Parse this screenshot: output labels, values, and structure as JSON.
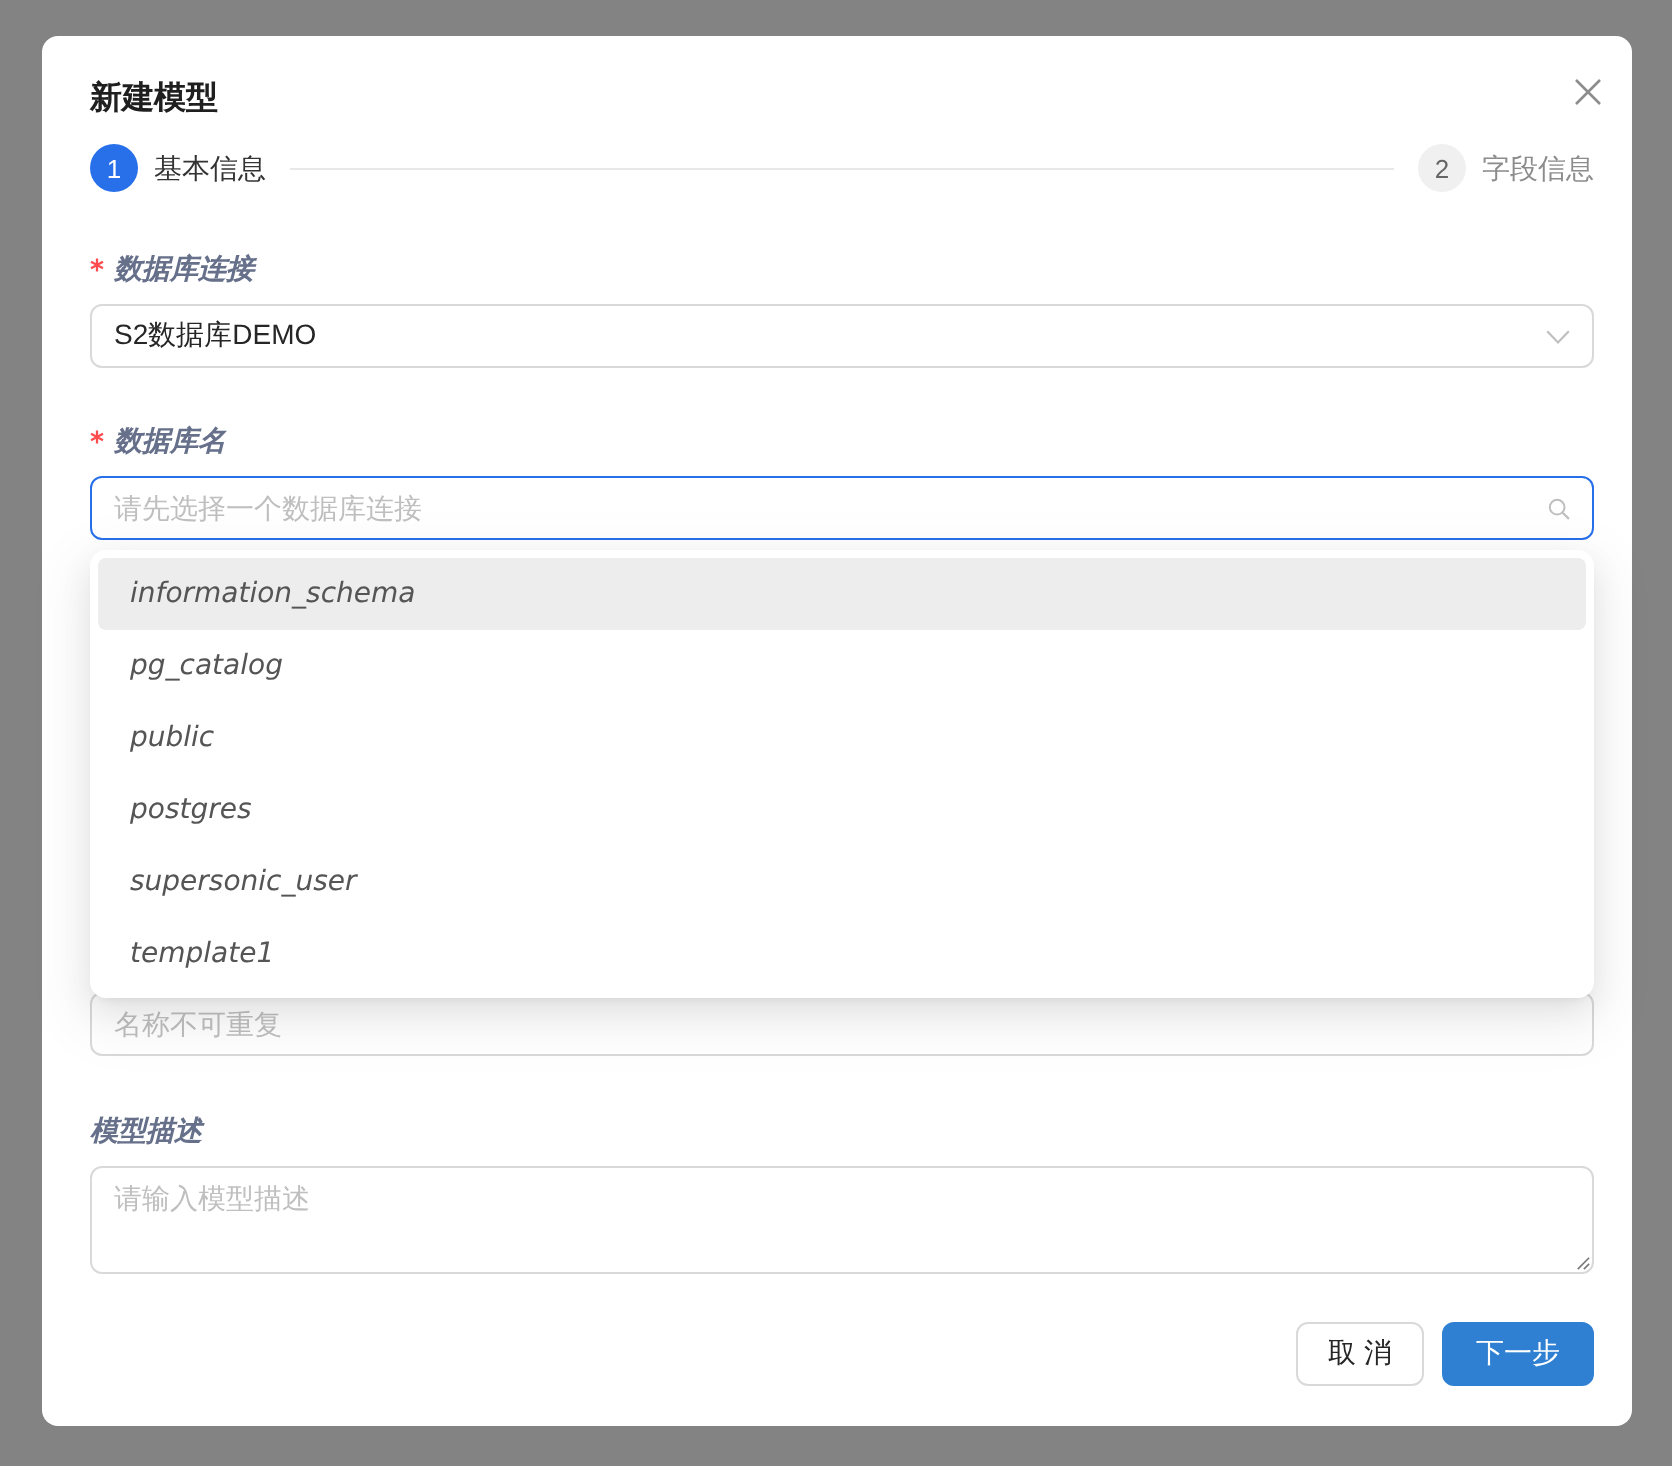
{
  "dialog": {
    "title": "新建模型"
  },
  "steps": [
    {
      "number": "1",
      "label": "基本信息",
      "selected": true
    },
    {
      "number": "2",
      "label": "字段信息",
      "selected": false
    }
  ],
  "fields": [
    {
      "kind": "select",
      "label": "数据库连接",
      "required": true,
      "value": "S2数据库DEMO",
      "focused": false
    },
    {
      "kind": "search",
      "label": "数据库名",
      "required": true,
      "placeholder": "请先选择一个数据库连接",
      "focused": true,
      "options": [
        {
          "label": "information_schema",
          "selected": true
        },
        {
          "label": "pg_catalog",
          "selected": false
        },
        {
          "label": "public",
          "selected": false
        },
        {
          "label": "postgres",
          "selected": false
        },
        {
          "label": "supersonic_user",
          "selected": false
        },
        {
          "label": "template1",
          "selected": false
        }
      ]
    },
    {
      "kind": "input",
      "placeholder": "名称不可重复",
      "focused": false
    },
    {
      "kind": "textarea",
      "label": "模型描述",
      "required": false,
      "placeholder": "请输入模型描述",
      "focused": false
    }
  ],
  "buttons": [
    {
      "label": "取 消",
      "kind": "default"
    },
    {
      "label": "下一步",
      "kind": "primary"
    }
  ]
}
